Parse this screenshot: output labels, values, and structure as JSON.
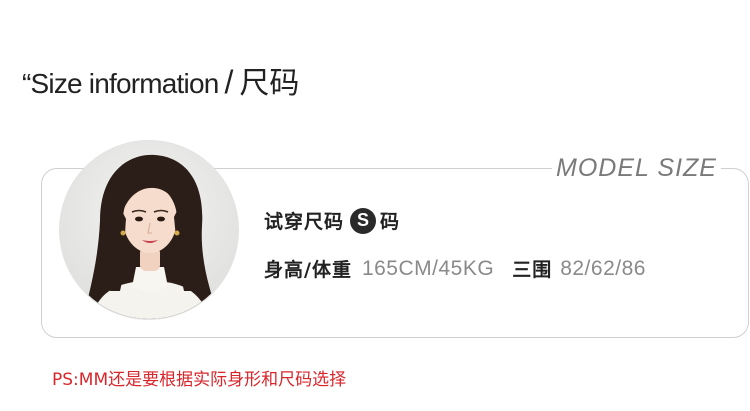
{
  "header": {
    "title_en": "“Size information",
    "separator": "/",
    "title_cn": "尺码"
  },
  "card": {
    "model_label": "MODEL SIZE",
    "try_on_label": "试穿尺码",
    "size_value": "S",
    "size_suffix": "码",
    "height_weight_label": "身高/体重",
    "height_weight_value": "165CM/45KG",
    "measurements_label": "三围",
    "measurements_value": "82/62/86"
  },
  "footer": {
    "note": "PS:MM还是要根据实际身形和尺码选择"
  },
  "colors": {
    "note_red": "#d8262b",
    "badge_dark": "#2a2a2a",
    "label_gray": "#7a7a7a"
  }
}
